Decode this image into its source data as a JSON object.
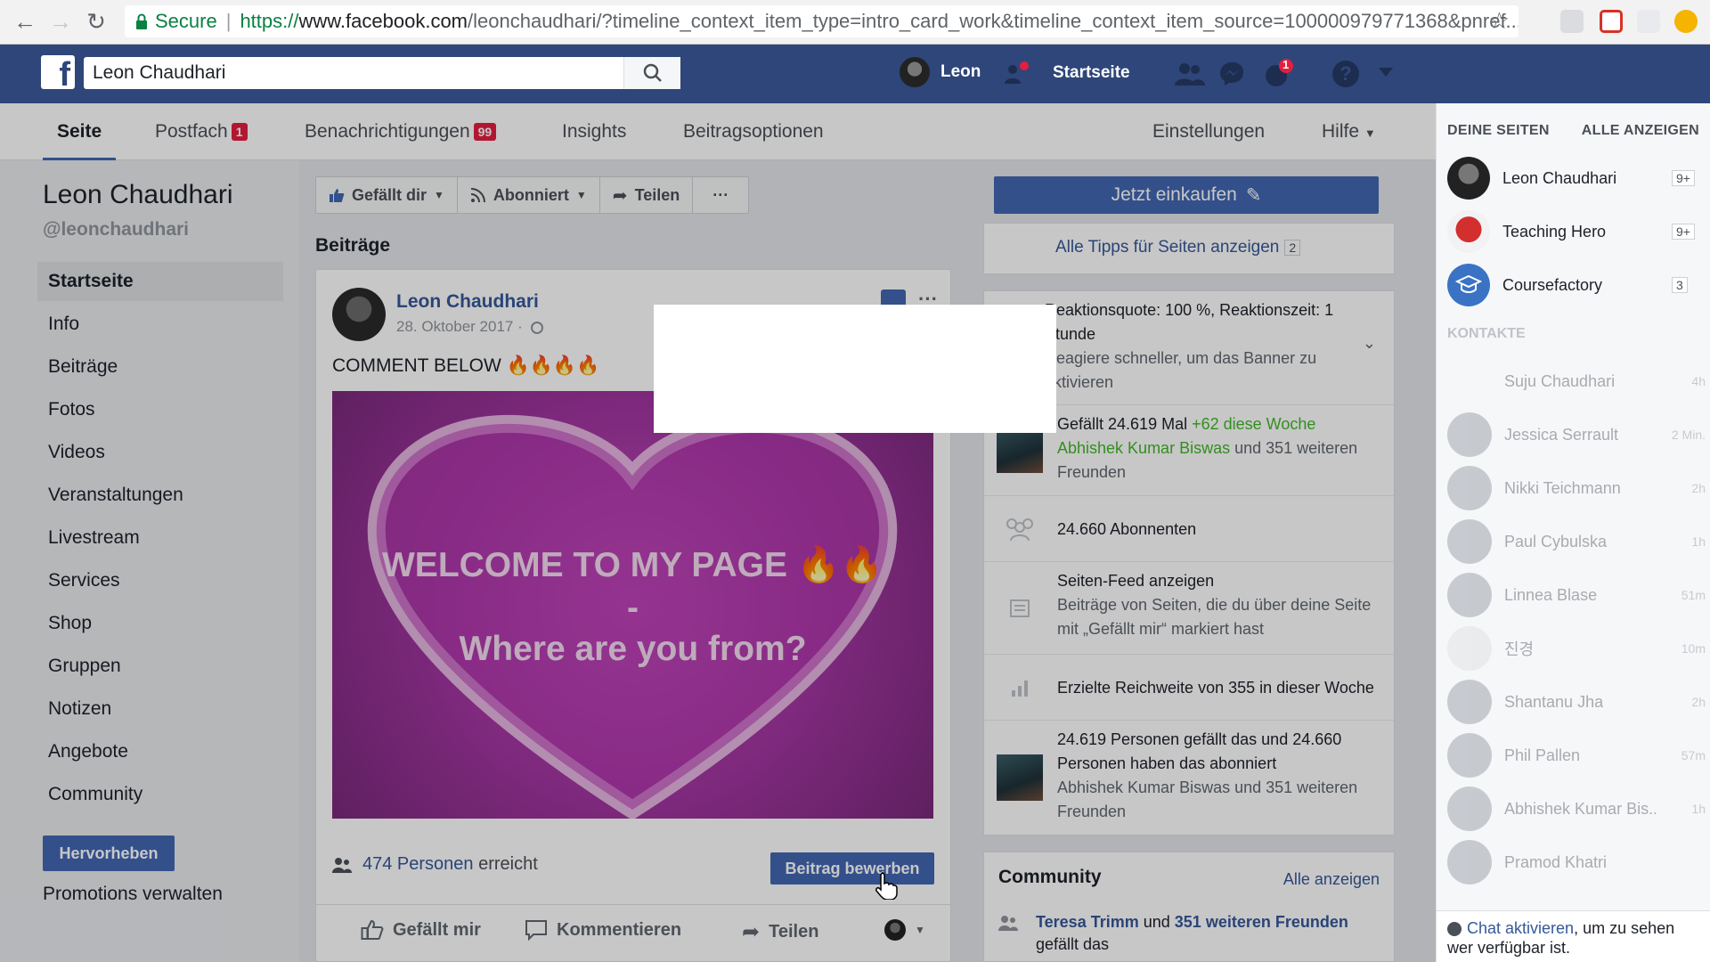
{
  "browser": {
    "secure_label": "Secure",
    "url_protocol": "https://",
    "url_host": "www.facebook.com",
    "url_path": "/leonchaudhari/?timeline_context_item_type=intro_card_work&timeline_context_item_source=100000979771368&pnref..."
  },
  "fb_header": {
    "search_value": "Leon Chaudhari",
    "profile_name": "Leon",
    "home_label": "Startseite",
    "notification_count": "1"
  },
  "page_tabs": [
    {
      "label": "Seite"
    },
    {
      "label": "Postfach",
      "badge": "1"
    },
    {
      "label": "Benachrichtigungen",
      "badge": "99"
    },
    {
      "label": "Insights"
    },
    {
      "label": "Beitragsoptionen"
    },
    {
      "label": "Einstellungen"
    },
    {
      "label": "Hilfe"
    }
  ],
  "left_nav": {
    "page_name": "Leon Chaudhari",
    "handle": "@leonchaudhari",
    "items": [
      "Startseite",
      "Info",
      "Beiträge",
      "Fotos",
      "Videos",
      "Veranstaltungen",
      "Livestream",
      "Services",
      "Shop",
      "Gruppen",
      "Notizen",
      "Angebote",
      "Community"
    ],
    "promote_button": "Hervorheben",
    "promotions_link": "Promotions verwalten"
  },
  "action_bar": {
    "like": "Gefällt dir",
    "follow": "Abonniert",
    "share": "Teilen",
    "more": "···"
  },
  "posts_heading": "Beiträge",
  "post": {
    "author": "Leon Chaudhari",
    "date": "28. Oktober 2017 ·",
    "text": "COMMENT BELOW 🔥🔥🔥🔥",
    "image_line1": "WELCOME TO MY PAGE 🔥🔥",
    "image_line2": "-",
    "image_line3": "Where are you from?",
    "reach_count": "474 Personen",
    "reach_suffix": "erreicht",
    "boost_button": "Beitrag bewerben",
    "like_action": "Gefällt mir",
    "comment_action": "Kommentieren",
    "share_action": "Teilen"
  },
  "sidebar_cards": {
    "shop_button": "Jetzt einkaufen",
    "tips_link": "Alle Tipps für Seiten anzeigen",
    "tips_count": "2",
    "response_line1": "Reaktionsquote: 100 %, Reaktionszeit: 1",
    "response_line2": "Stunde",
    "response_line3": "Reagiere schneller, um das Banner zu",
    "response_line4": "aktivieren",
    "likes_prefix": "Gefällt 24.619 Mal ",
    "likes_week": "+62 diese Woche",
    "likes_friend": "Abhishek Kumar Biswas",
    "likes_friend_suffix": " und 351 weiteren",
    "likes_friend_line2": "Freunden",
    "followers": "24.660 Abonnenten",
    "feed_title": "Seiten-Feed anzeigen",
    "feed_desc1": "Beiträge von Seiten, die du über deine Seite",
    "feed_desc2": "mit „Gefällt mir“ markiert hast",
    "reach_week": "Erzielte Reichweite von 355 in dieser Woche",
    "summary_line1": "24.619 Personen gefällt das und 24.660",
    "summary_line2": "Personen haben das abonniert",
    "summary_line3": "Abhishek Kumar Biswas und 351 weiteren",
    "summary_line4": "Freunden",
    "community_title": "Community",
    "community_all": "Alle anzeigen",
    "community_person": "Teresa Trimm",
    "community_and": " und ",
    "community_friends": "351 weiteren Freunden",
    "community_suffix": "gefällt das"
  },
  "right_sidebar": {
    "your_pages": "DEINE SEITEN",
    "show_all": "ALLE ANZEIGEN",
    "pages": [
      {
        "name": "Leon Chaudhari",
        "count": "9+"
      },
      {
        "name": "Teaching Hero",
        "count": "9+"
      },
      {
        "name": "Coursefactory",
        "count": "3"
      }
    ],
    "contacts_heading": "KONTAKTE",
    "contacts": [
      {
        "name": "Suju Chaudhari",
        "time": "4h"
      },
      {
        "name": "Jessica Serrault",
        "time": "2 Min."
      },
      {
        "name": "Nikki Teichmann",
        "time": "2h"
      },
      {
        "name": "Paul Cybulska",
        "time": "1h"
      },
      {
        "name": "Linnea Blase",
        "time": "51m"
      },
      {
        "name": "진경",
        "time": "10m"
      },
      {
        "name": "Shantanu Jha",
        "time": "2h"
      },
      {
        "name": "Phil Pallen",
        "time": "57m"
      },
      {
        "name": "Abhishek Kumar Bis...",
        "time": "1h"
      },
      {
        "name": "Pramod Khatri",
        "time": ""
      }
    ],
    "chat_link": "Chat aktivieren",
    "chat_text": ", um zu sehen wer verfügbar ist."
  },
  "colors": {
    "facebook_blue": "#4267b2",
    "header_blue": "#2e4679",
    "badge_red": "#e41e3f",
    "link_blue": "#365899"
  }
}
